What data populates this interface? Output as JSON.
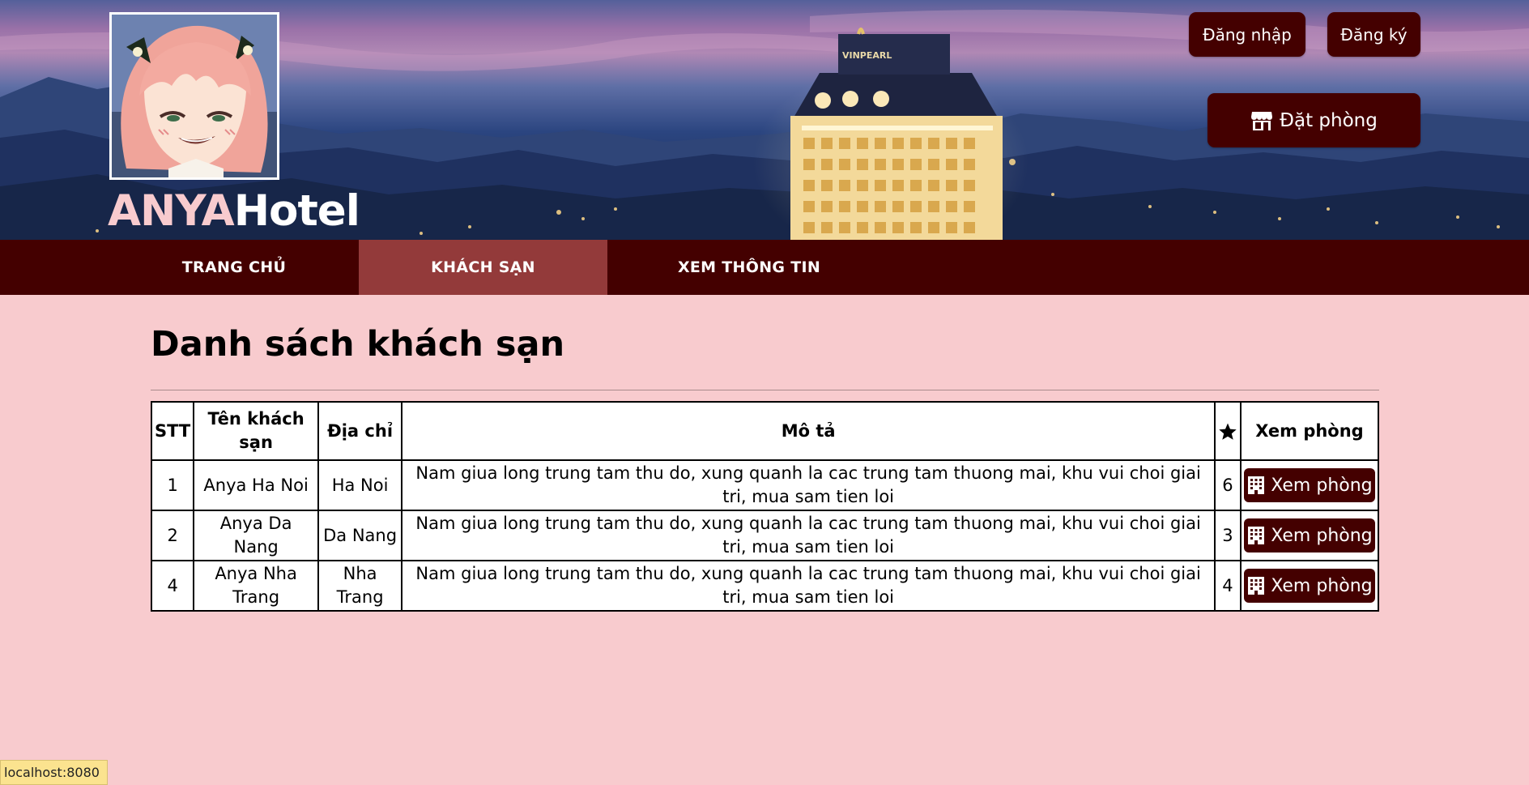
{
  "header": {
    "brand_part1": "ANYA",
    "brand_part2": "Hotel",
    "hotel_sign": "VINPEARL",
    "login_label": "Đăng nhập",
    "register_label": "Đăng ký",
    "book_label": "Đặt phòng"
  },
  "nav": {
    "items": [
      {
        "label": "TRANG CHỦ"
      },
      {
        "label": "KHÁCH SẠN"
      },
      {
        "label": "XEM THÔNG TIN"
      }
    ],
    "active": "KHÁCH SẠN"
  },
  "main": {
    "title": "Danh sách khách sạn",
    "table": {
      "headers": {
        "stt": "STT",
        "name": "Tên khách sạn",
        "address": "Địa chỉ",
        "description": "Mô tả",
        "rating_icon": "star-icon",
        "view": "Xem phòng"
      },
      "rows": [
        {
          "stt": "1",
          "name": "Anya Ha Noi",
          "address": "Ha Noi",
          "description": "Nam giua long trung tam thu do, xung quanh la cac trung tam thuong mai, khu vui choi giai tri, mua sam tien loi",
          "rating": "6",
          "action": "Xem phòng"
        },
        {
          "stt": "2",
          "name": "Anya Da Nang",
          "address": "Da Nang",
          "description": "Nam giua long trung tam thu do, xung quanh la cac trung tam thuong mai, khu vui choi giai tri, mua sam tien loi",
          "rating": "3",
          "action": "Xem phòng"
        },
        {
          "stt": "4",
          "name": "Anya Nha Trang",
          "address": "Nha Trang",
          "description": "Nam giua long trung tam thu do, xung quanh la cac trung tam thuong mai, khu vui choi giai tri, mua sam tien loi",
          "rating": "4",
          "action": "Xem phòng"
        }
      ]
    }
  },
  "status_bar": {
    "url": "localhost:8080"
  },
  "colors": {
    "page_background": "#f8cbce",
    "primary_dark": "#440000",
    "nav_active": "#933a3a",
    "brand_accent": "#f8cbce",
    "status_bar": "#fbe38f"
  }
}
